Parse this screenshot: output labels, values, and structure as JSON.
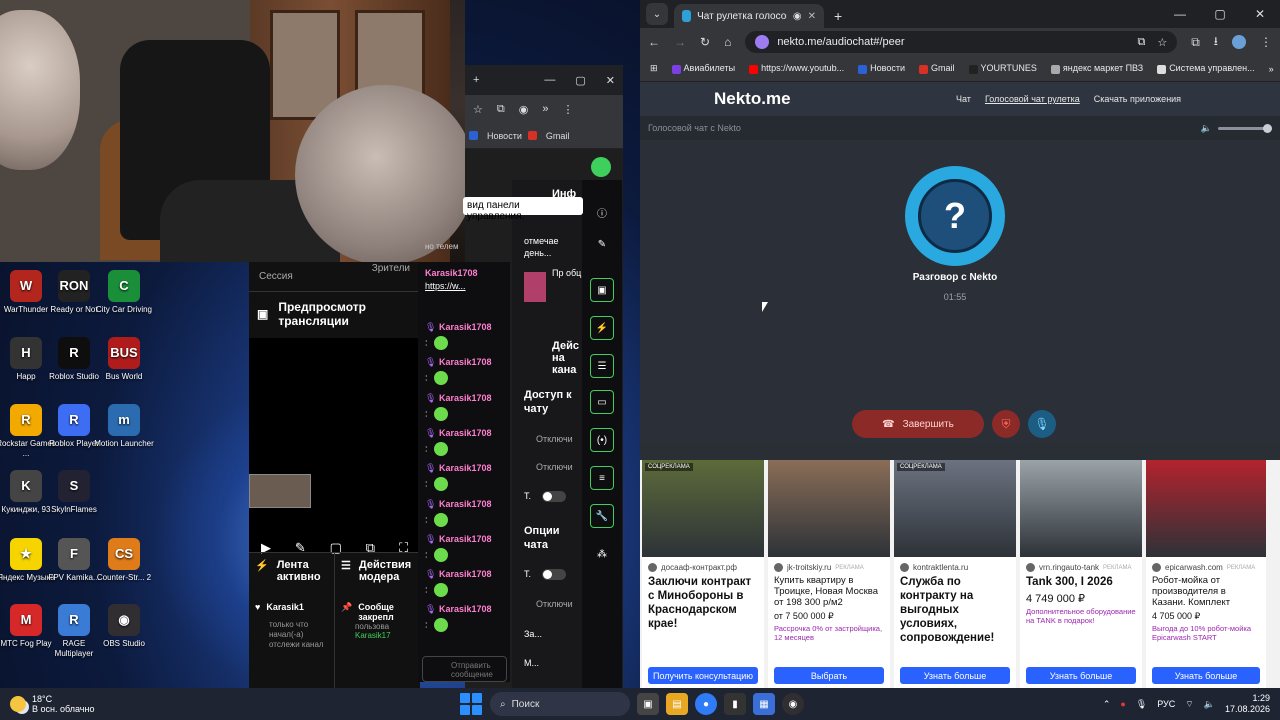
{
  "desktop": {
    "icons": [
      {
        "label": "WarThunder",
        "color": "#b3261e",
        "glyph": "W"
      },
      {
        "label": "Ready or Not",
        "color": "#222",
        "glyph": "RON"
      },
      {
        "label": "City Car Driving",
        "color": "#1b8e3a",
        "glyph": "C"
      },
      {
        "label": "Happ",
        "color": "#333",
        "glyph": "H"
      },
      {
        "label": "Roblox Studio",
        "color": "#0e0e0e",
        "glyph": "R"
      },
      {
        "label": "Bus World",
        "color": "#b01c1c",
        "glyph": "BUS"
      },
      {
        "label": "Rockstar Games ...",
        "color": "#f2a900",
        "glyph": "R"
      },
      {
        "label": "Roblox Player",
        "color": "#3d6df2",
        "glyph": "R"
      },
      {
        "label": "Motion Launcher",
        "color": "#2b6cb0",
        "glyph": "m"
      },
      {
        "label": "Кукинджи, 93",
        "color": "#444",
        "glyph": "K"
      },
      {
        "label": "SkylnFlames",
        "color": "#223",
        "glyph": "S"
      },
      {
        "label": "Яндекс Музыка",
        "color": "#f5d400",
        "glyph": "★"
      },
      {
        "label": "FPV Kamika...",
        "color": "#555",
        "glyph": "F"
      },
      {
        "label": "Counter-Str... 2",
        "color": "#e07b1a",
        "glyph": "CS"
      },
      {
        "label": "MTC Fog Play",
        "color": "#d62828",
        "glyph": "M"
      },
      {
        "label": "RAGE Multiplayer",
        "color": "#3a7bd5",
        "glyph": "R"
      },
      {
        "label": "OBS Studio",
        "color": "#302e31",
        "glyph": "◉"
      }
    ]
  },
  "obs": {
    "session_label": "Сессия",
    "viewers_label": "Зрители",
    "preview_title": "Предпросмотр трансляции",
    "feed_title": "Лента активно",
    "mod_title": "Действия модера",
    "feed_user": "Karasik1",
    "feed_text": "только что начал(-а) отслежи канал",
    "mod_heading": "Сообще закрепл",
    "mod_by": "пользова",
    "mod_user": "Karasik17",
    "reply_label": "Отправить сообщение"
  },
  "chat": {
    "top_user": "Karasik1708",
    "top_link": "https://w...",
    "messages": [
      "Karasik1708",
      "Karasik1708",
      "Karasik1708",
      "Karasik1708",
      "Karasik1708",
      "Karasik1708",
      "Karasik1708",
      "Karasik1708",
      "Karasik1708"
    ],
    "partial_top": "но телем"
  },
  "side_panel": {
    "tooltip": "вид панели управления.",
    "info_title": "Инф тран",
    "mark_text": "отмечае день...",
    "pin_a": "Пр обц",
    "actions_title": "Дейс на кана",
    "access_title": "Доступ к чату",
    "off1": "Отключи",
    "off2": "Отключи",
    "t_label1": "Т.",
    "options_title": "Опции чата",
    "t_label2": "Т.",
    "off3": "Отключи",
    "misc1": "За...",
    "misc2": "М..."
  },
  "back_browser": {
    "bookmark_news": "Новости",
    "bookmark_gmail": "Gmail"
  },
  "chrome": {
    "tab_title": "Чат рулетка голосовая —",
    "url": "nekto.me/audiochat#/peer",
    "bookmarks": [
      {
        "label": "Авиабилеты",
        "color": "#7b3fe4"
      },
      {
        "label": "https://www.youtub...",
        "color": "#ff0000"
      },
      {
        "label": "Новости",
        "color": "#2a62d6"
      },
      {
        "label": "Gmail",
        "color": "#d93025"
      },
      {
        "label": "YOURTUNES",
        "color": "#222"
      },
      {
        "label": "яндекс маркет ПВЗ",
        "color": "#aaa"
      },
      {
        "label": "Система управлен...",
        "color": "#ddd"
      }
    ]
  },
  "site": {
    "logo": "Nekto.me",
    "nav": [
      "Чат",
      "Голосовой чат рулетка",
      "Скачать приложения"
    ],
    "subheader": "Голосовой чат с Nekto",
    "avatar_mark": "?",
    "talk_label": "Разговор с Nekto",
    "timer": "01:55",
    "end_button": "Завершить"
  },
  "ads": [
    {
      "badge": "СОЦРЕКЛАМА",
      "source": "досааф-контракт.рф",
      "tag": "",
      "title": "Заключи контракт с Минобороны в Краснодарском крае!",
      "price": "",
      "note": "",
      "cta": "Получить консультацию",
      "img": "#5d6b3a"
    },
    {
      "badge": "",
      "source": "jk-troitskiy.ru",
      "tag": "РЕКЛАМА",
      "title": "Купить квартиру в Троицке, Новая Москва от 198 300 р/м2",
      "price": "от 7 500 000 ₽",
      "note": "Рассрочка 0% от застройщика, 12 месяцев",
      "cta": "Выбрать",
      "img": "#8a6d57"
    },
    {
      "badge": "СОЦРЕКЛАМА",
      "source": "kontraktlenta.ru",
      "tag": "",
      "title": "Служба по контракту на выгодных условиях, сопровождение!",
      "price": "",
      "note": "",
      "cta": "Узнать больше",
      "img": "#6c7380"
    },
    {
      "badge": "",
      "source": "vrn.ringauto-tank",
      "tag": "РЕКЛАМА",
      "title": "Tank 300, I 2026",
      "price": "4 749 000 ₽",
      "note": "Дополнительное оборудование на TANK в подарок!",
      "cta": "Узнать больше",
      "img": "#9aa3a8"
    },
    {
      "badge": "",
      "source": "epicarwash.com",
      "tag": "РЕКЛАМА",
      "title": "Робот-мойка от производителя в Казани. Комплект",
      "price": "4 705 000 ₽",
      "note": "Выгода до 10% робот-мойка Epicarwash START",
      "cta": "Узнать больше",
      "img": "#b3232d"
    }
  ],
  "taskbar": {
    "temp": "18°C",
    "weather": "В осн. облачно",
    "search": "Поиск",
    "lang": "РУС",
    "time": "1:29",
    "date": "17.08.2026"
  }
}
